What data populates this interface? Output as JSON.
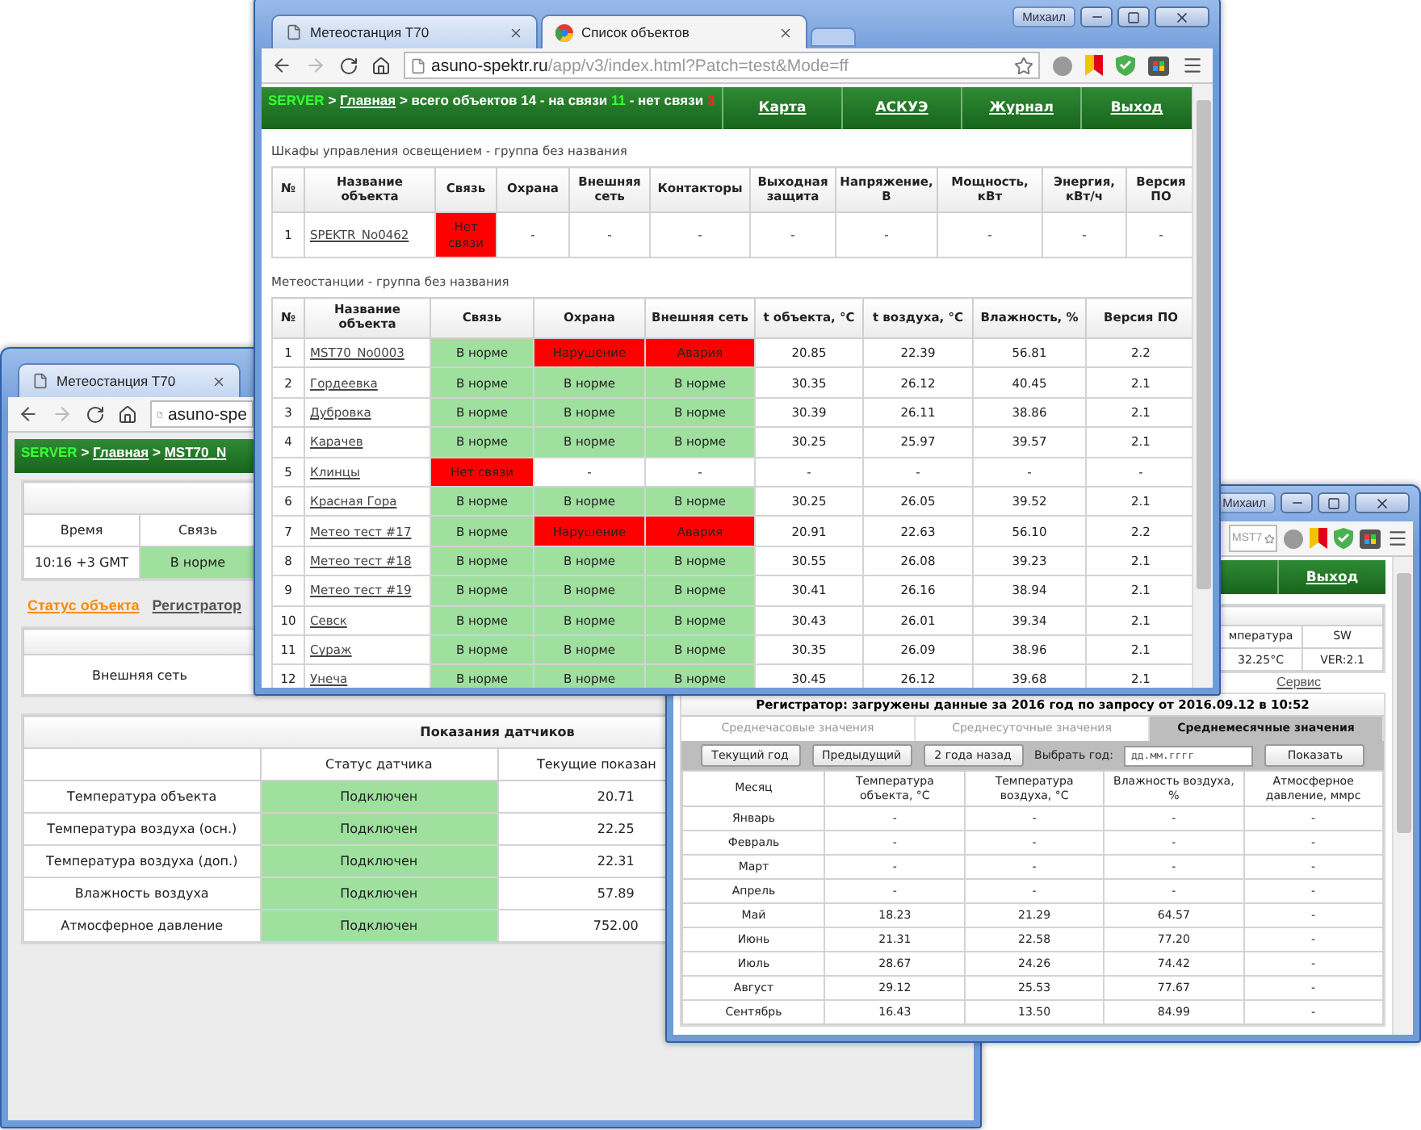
{
  "station_window": {
    "tab": "Метеостанция T70",
    "url": "asuno-spe",
    "breadcrumb": [
      {
        "text": "SERVER",
        "kind": "server"
      },
      {
        "text": ">",
        "kind": "text"
      },
      {
        "text": "Главная",
        "kind": "link"
      },
      {
        "text": ">",
        "kind": "text"
      },
      {
        "text": "MST70_N",
        "kind": "link"
      }
    ],
    "info": {
      "columns": [
        "Время",
        "Связь"
      ],
      "values": [
        {
          "text": "10:16 +3 GMT"
        },
        {
          "text": "В норме",
          "color": "#9fe09f"
        }
      ]
    },
    "links": [
      {
        "label": "Статус объекта",
        "selected": true
      },
      {
        "label": "Регистратор",
        "selected": false
      }
    ],
    "network_label": "Внешняя сеть",
    "sensors": {
      "title": "Показания датчиков",
      "columns": [
        "Статус датчика",
        "Текущие показан"
      ],
      "rows": [
        {
          "name": "Температура объекта",
          "status": {
            "text": "Подключен",
            "color": "#9fe09f"
          },
          "value": "20.71"
        },
        {
          "name": "Температура воздуха (осн.)",
          "status": {
            "text": "Подключен",
            "color": "#9fe09f"
          },
          "value": "22.25"
        },
        {
          "name": "Температура воздуха (доп.)",
          "status": {
            "text": "Подключен",
            "color": "#9fe09f"
          },
          "value": "22.31"
        },
        {
          "name": "Влажность воздуха",
          "status": {
            "text": "Подключен",
            "color": "#9fe09f"
          },
          "value": "57.89"
        },
        {
          "name": "Атмосферное давление",
          "status": {
            "text": "Подключен",
            "color": "#9fe09f"
          },
          "value": "752.00"
        }
      ]
    }
  },
  "main_window": {
    "tabs": [
      {
        "title": "Метеостанция T70",
        "selected": false
      },
      {
        "title": "Список объектов",
        "selected": true
      }
    ],
    "user": "Михаил",
    "url_host": "asuno-spektr.ru",
    "url_path": "/app/v3/index.html?Patch=test&Mode=ff",
    "breadcrumb": [
      {
        "text": "SERVER",
        "kind": "server"
      },
      {
        "text": ">",
        "kind": "text"
      },
      {
        "text": "Главная",
        "kind": "link"
      },
      {
        "text": "> всего объектов 14 - на связи",
        "kind": "text"
      },
      {
        "text": "11",
        "kind": "ok"
      },
      {
        "text": "- нет связи",
        "kind": "text"
      },
      {
        "text": "3",
        "kind": "bad"
      }
    ],
    "nav": [
      "Карта",
      "АСКУЭ",
      "Журнал",
      "Выход"
    ],
    "groups": [
      {
        "title": "Шкафы управления освещением - группа без названия",
        "columns": [
          "№",
          "Название объекта",
          "Связь",
          "Охрана",
          "Внешняя сеть",
          "Контакторы",
          "Выходная защита",
          "Напряжение, В",
          "Мощность, кВт",
          "Энергия, кВт/ч",
          "Версия ПО"
        ],
        "rows": [
          {
            "no": "1",
            "name": "SPEKTR_No0462",
            "status": [
              {
                "text": "Нет связи",
                "color": "#ff0000"
              }
            ],
            "values": [
              "-",
              "-",
              "-",
              "-",
              "-",
              "-",
              "-",
              "-"
            ]
          }
        ]
      },
      {
        "title": "Метеостанции - группа без названия",
        "columns": [
          "№",
          "Название объекта",
          "Связь",
          "Охрана",
          "Внешняя сеть",
          "t объекта, °C",
          "t воздуха, °C",
          "Влажность, %",
          "Версия ПО"
        ],
        "rows": [
          {
            "no": "1",
            "name": "MST70_No0003",
            "status": [
              {
                "text": "В норме",
                "color": "#9fe09f"
              },
              {
                "text": "Нарушение",
                "color": "#ff0000"
              },
              {
                "text": "Авария",
                "color": "#ff0000"
              }
            ],
            "values": [
              "20.85",
              "22.39",
              "56.81",
              "2.2"
            ]
          },
          {
            "no": "2",
            "name": "Гордеевка",
            "status": [
              {
                "text": "В норме",
                "color": "#9fe09f"
              },
              {
                "text": "В норме",
                "color": "#9fe09f"
              },
              {
                "text": "В норме",
                "color": "#9fe09f"
              }
            ],
            "values": [
              "30.35",
              "26.12",
              "40.45",
              "2.1"
            ]
          },
          {
            "no": "3",
            "name": "Дубровка",
            "status": [
              {
                "text": "В норме",
                "color": "#9fe09f"
              },
              {
                "text": "В норме",
                "color": "#9fe09f"
              },
              {
                "text": "В норме",
                "color": "#9fe09f"
              }
            ],
            "values": [
              "30.39",
              "26.11",
              "38.86",
              "2.1"
            ]
          },
          {
            "no": "4",
            "name": "Карачев",
            "status": [
              {
                "text": "В норме",
                "color": "#9fe09f"
              },
              {
                "text": "В норме",
                "color": "#9fe09f"
              },
              {
                "text": "В норме",
                "color": "#9fe09f"
              }
            ],
            "values": [
              "30.25",
              "25.97",
              "39.57",
              "2.1"
            ]
          },
          {
            "no": "5",
            "name": "Клинцы",
            "status": [
              {
                "text": "Нет связи",
                "color": "#ff0000"
              },
              {
                "text": "-"
              },
              {
                "text": "-"
              }
            ],
            "values": [
              "-",
              "-",
              "-",
              "-"
            ]
          },
          {
            "no": "6",
            "name": "Красная Гора",
            "status": [
              {
                "text": "В норме",
                "color": "#9fe09f"
              },
              {
                "text": "В норме",
                "color": "#9fe09f"
              },
              {
                "text": "В норме",
                "color": "#9fe09f"
              }
            ],
            "values": [
              "30.25",
              "26.05",
              "39.52",
              "2.1"
            ]
          },
          {
            "no": "7",
            "name": "Метео тест #17",
            "status": [
              {
                "text": "В норме",
                "color": "#9fe09f"
              },
              {
                "text": "Нарушение",
                "color": "#ff0000"
              },
              {
                "text": "Авария",
                "color": "#ff0000"
              }
            ],
            "values": [
              "20.91",
              "22.63",
              "56.10",
              "2.2"
            ]
          },
          {
            "no": "8",
            "name": "Метео тест #18",
            "status": [
              {
                "text": "В норме",
                "color": "#9fe09f"
              },
              {
                "text": "В норме",
                "color": "#9fe09f"
              },
              {
                "text": "В норме",
                "color": "#9fe09f"
              }
            ],
            "values": [
              "30.55",
              "26.08",
              "39.23",
              "2.1"
            ]
          },
          {
            "no": "9",
            "name": "Метео тест #19",
            "status": [
              {
                "text": "В норме",
                "color": "#9fe09f"
              },
              {
                "text": "В норме",
                "color": "#9fe09f"
              },
              {
                "text": "В норме",
                "color": "#9fe09f"
              }
            ],
            "values": [
              "30.41",
              "26.16",
              "38.94",
              "2.1"
            ]
          },
          {
            "no": "10",
            "name": "Севск",
            "status": [
              {
                "text": "В норме",
                "color": "#9fe09f"
              },
              {
                "text": "В норме",
                "color": "#9fe09f"
              },
              {
                "text": "В норме",
                "color": "#9fe09f"
              }
            ],
            "values": [
              "30.43",
              "26.01",
              "39.34",
              "2.1"
            ]
          },
          {
            "no": "11",
            "name": "Сураж",
            "status": [
              {
                "text": "В норме",
                "color": "#9fe09f"
              },
              {
                "text": "В норме",
                "color": "#9fe09f"
              },
              {
                "text": "В норме",
                "color": "#9fe09f"
              }
            ],
            "values": [
              "30.35",
              "26.09",
              "38.96",
              "2.1"
            ]
          },
          {
            "no": "12",
            "name": "Унеча",
            "status": [
              {
                "text": "В норме",
                "color": "#9fe09f"
              },
              {
                "text": "В норме",
                "color": "#9fe09f"
              },
              {
                "text": "В норме",
                "color": "#9fe09f"
              }
            ],
            "values": [
              "30.45",
              "26.12",
              "39.68",
              "2.1"
            ]
          }
        ]
      }
    ]
  },
  "registrator_window": {
    "user": "Михаил",
    "url": "MST7",
    "nav": [
      "Выход"
    ],
    "info": {
      "columns": [
        "мпература",
        "SW"
      ],
      "values": [
        "32.25°C",
        "VER:2.1"
      ]
    },
    "links": [
      "Сервис"
    ],
    "registrator": {
      "title": "Регистратор: загружены данные за 2016 год по запросу от 2016.09.12 в 10:52",
      "tabs": [
        {
          "label": "Среднечасовые значения",
          "selected": false
        },
        {
          "label": "Среднесуточные значения",
          "selected": false
        },
        {
          "label": "Среднемесячные значения",
          "selected": true
        }
      ],
      "buttons": [
        "Текущий год",
        "Предыдущий",
        "2 года назад"
      ],
      "year_label": "Выбрать год:",
      "year_field": {
        "placeholder": "дд.мм.гггг"
      },
      "show_button": "Показать",
      "columns": [
        "Месяц",
        "Температура объекта, °C",
        "Температура воздуха, °C",
        "Влажность воздуха, %",
        "Атмосферное давление, ммрс"
      ],
      "rows": [
        [
          "Январь",
          "-",
          "-",
          "-",
          "-"
        ],
        [
          "Февраль",
          "-",
          "-",
          "-",
          "-"
        ],
        [
          "Март",
          "-",
          "-",
          "-",
          "-"
        ],
        [
          "Апрель",
          "-",
          "-",
          "-",
          "-"
        ],
        [
          "Май",
          "18.23",
          "21.29",
          "64.57",
          "-"
        ],
        [
          "Июнь",
          "21.31",
          "22.58",
          "77.20",
          "-"
        ],
        [
          "Июль",
          "28.67",
          "24.26",
          "74.42",
          "-"
        ],
        [
          "Август",
          "29.12",
          "25.53",
          "77.67",
          "-"
        ],
        [
          "Сентябрь",
          "16.43",
          "13.50",
          "84.99",
          "-"
        ]
      ]
    }
  }
}
